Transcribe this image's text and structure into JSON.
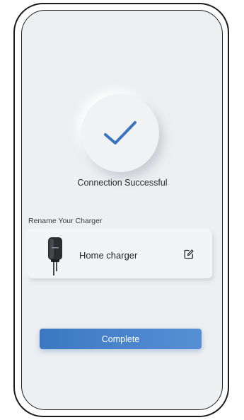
{
  "status": {
    "title": "Connection Successful",
    "icon": "checkmark-icon",
    "accent_color": "#3a74bd"
  },
  "rename": {
    "label": "Rename Your Charger",
    "charger_name": "Home charger",
    "charger_icon": "wallbox-charger-icon",
    "edit_icon": "edit-icon"
  },
  "actions": {
    "complete_label": "Complete",
    "button_color": "#3c78c2"
  }
}
